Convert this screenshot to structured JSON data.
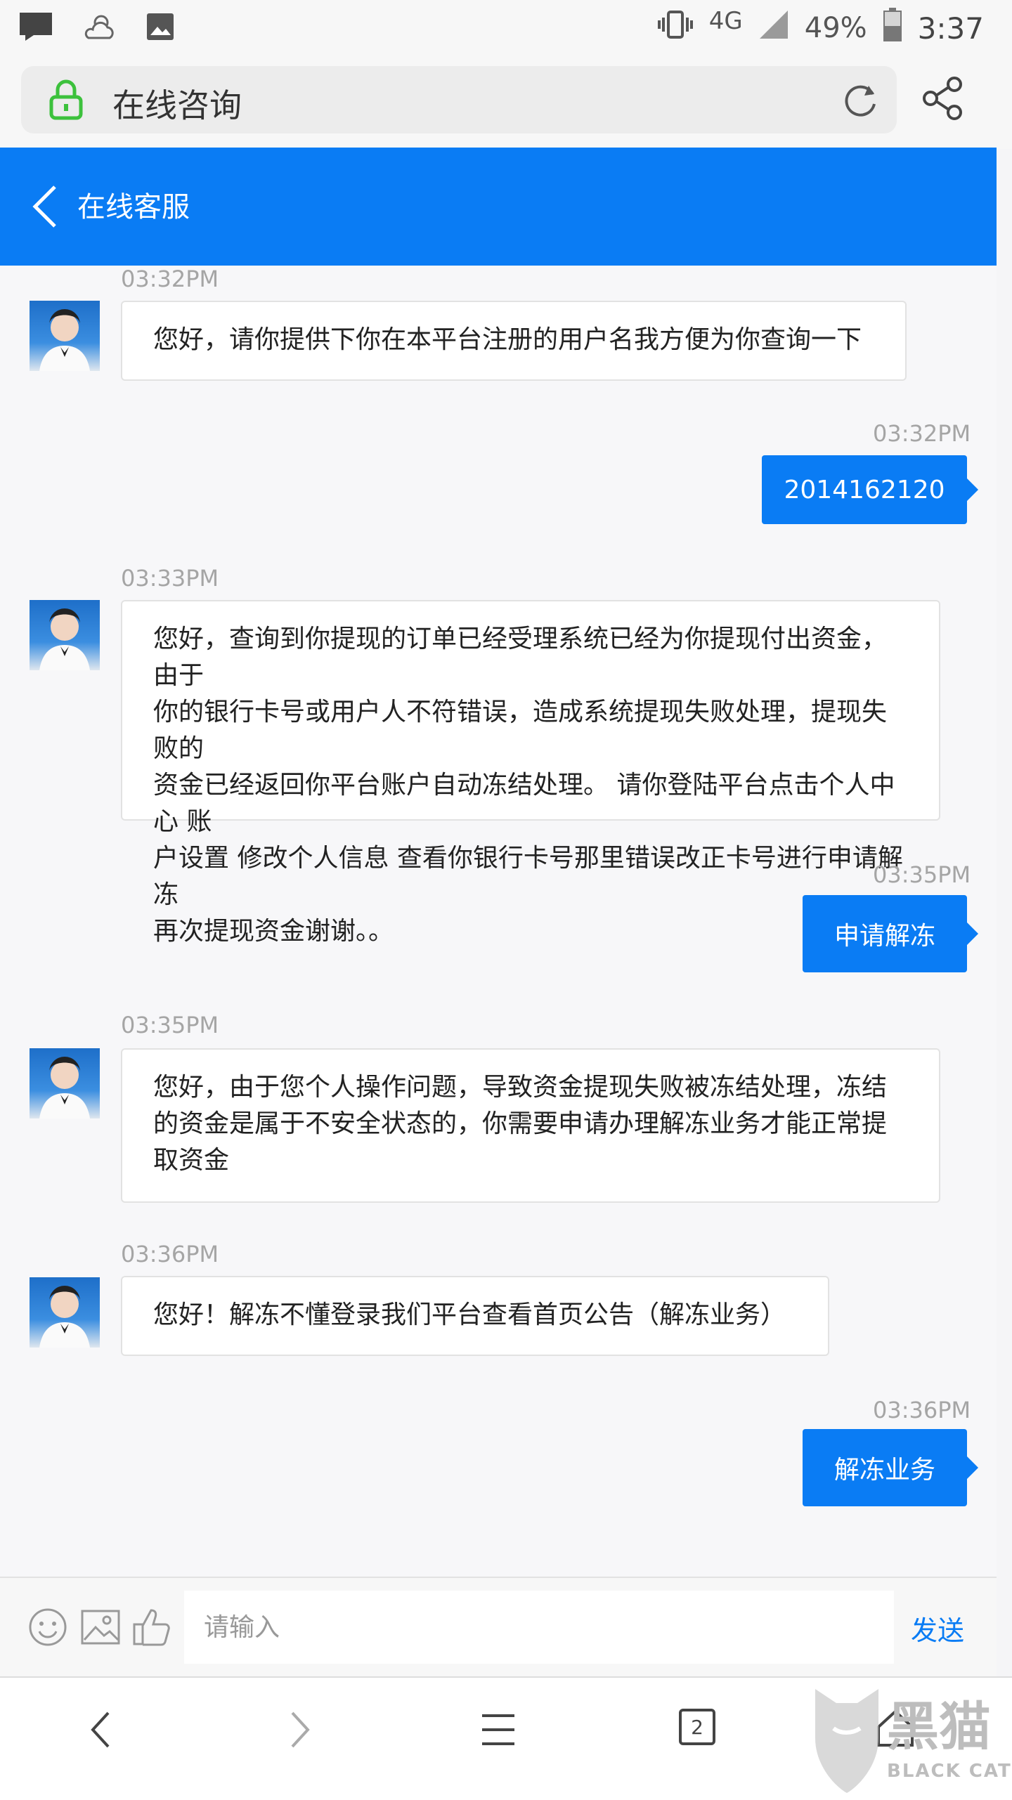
{
  "status_bar": {
    "network": "4G",
    "battery": "49%",
    "time": "3:37"
  },
  "browser": {
    "page_title": "在线咨询"
  },
  "header": {
    "title": "在线客服"
  },
  "messages": [
    {
      "side": "in",
      "time": "03:32PM",
      "text": "您好，请你提供下你在本平台注册的用户名我方便为你查询一下"
    },
    {
      "side": "out",
      "time": "03:32PM",
      "text": "2014162120"
    },
    {
      "side": "in",
      "time": "03:33PM",
      "lines": [
        "您好，查询到你提现的订单已经受理系统已经为你提现付出资金，由于",
        "你的银行卡号或用户人不符错误，造成系统提现失败处理，提现失败的",
        "资金已经返回你平台账户自动冻结处理。 请你登陆平台点击个人中心 账",
        "户设置  修改个人信息  查看你银行卡号那里错误改正卡号进行申请解冻",
        "再次提现资金谢谢。。"
      ]
    },
    {
      "side": "out",
      "time": "03:35PM",
      "text": "申请解冻"
    },
    {
      "side": "in",
      "time": "03:35PM",
      "lines": [
        "您好，由于您个人操作问题，导致资金提现失败被冻结处理，冻结",
        "的资金是属于不安全状态的，你需要申请办理解冻业务才能正常提",
        "取资金"
      ]
    },
    {
      "side": "in",
      "time": "03:36PM",
      "text": "您好！解冻不懂登录我们平台查看首页公告（解冻业务）"
    },
    {
      "side": "out",
      "time": "03:36PM",
      "text": "解冻业务"
    }
  ],
  "input": {
    "placeholder": "请输入",
    "send_label": "发送"
  },
  "nav": {
    "tab_count": "2"
  },
  "watermark": {
    "cn": "黑猫",
    "en": "BLACK CAT"
  },
  "colors": {
    "accent": "#0a7cf4",
    "lock": "#3cc13c"
  }
}
